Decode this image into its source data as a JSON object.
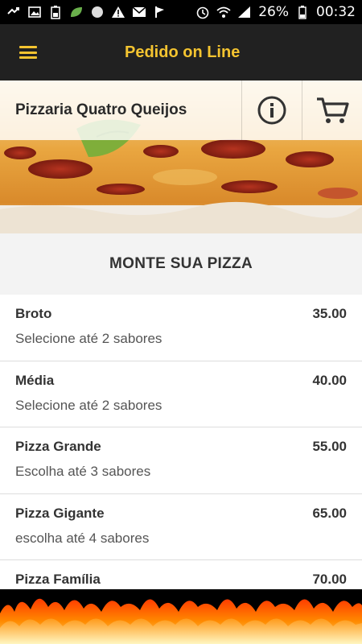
{
  "status_bar": {
    "battery": "26%",
    "time": "00:32",
    "icons": [
      "missed-call-icon",
      "image-icon",
      "battery-saver-icon",
      "leaf-icon",
      "circle-icon",
      "warning-icon",
      "mail-icon",
      "flag-icon",
      "alarm-icon",
      "wifi-icon",
      "signal-icon",
      "battery-icon"
    ]
  },
  "app_bar": {
    "title": "Pedido on Line",
    "accent": "#f4c430",
    "background": "#212121"
  },
  "hero": {
    "restaurant_name": "Pizzaria Quatro Queijos",
    "info_icon": "info-icon",
    "cart_icon": "cart-icon"
  },
  "section": {
    "title": "MONTE SUA PIZZA"
  },
  "pizzas": [
    {
      "name": "Broto",
      "price": "35.00",
      "desc": "Selecione até 2 sabores"
    },
    {
      "name": "Média",
      "price": "40.00",
      "desc": "Selecione até 2 sabores"
    },
    {
      "name": "Pizza Grande",
      "price": "55.00",
      "desc": "Escolha até 3 sabores"
    },
    {
      "name": "Pizza Gigante",
      "price": "65.00",
      "desc": "escolha até 4 sabores"
    },
    {
      "name": "Pizza Família",
      "price": "70.00",
      "desc": ""
    }
  ]
}
